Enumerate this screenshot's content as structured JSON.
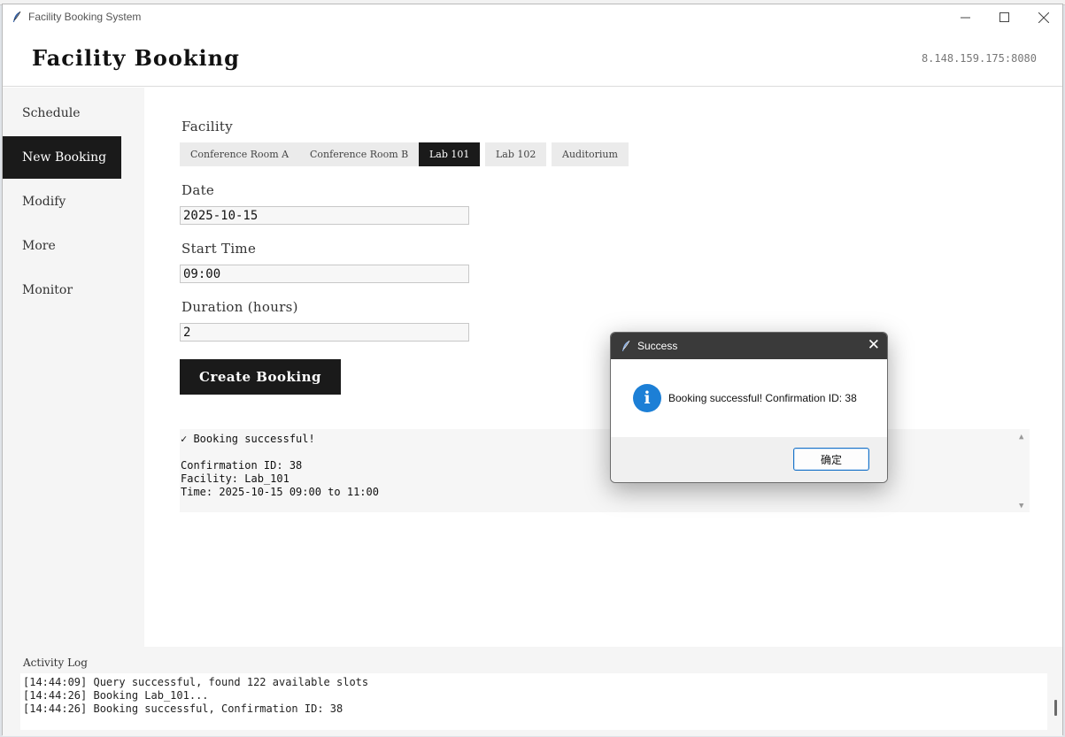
{
  "window": {
    "title": "Facility Booking System"
  },
  "header": {
    "title": "Facility Booking",
    "server": "8.148.159.175:8080"
  },
  "sidebar": {
    "items": [
      {
        "label": "Schedule",
        "active": false
      },
      {
        "label": "New Booking",
        "active": true
      },
      {
        "label": "Modify",
        "active": false
      },
      {
        "label": "More",
        "active": false
      },
      {
        "label": "Monitor",
        "active": false
      }
    ]
  },
  "form": {
    "facility_label": "Facility",
    "facilities": [
      {
        "label": "Conference Room A",
        "active": false
      },
      {
        "label": "Conference Room B",
        "active": false
      },
      {
        "label": "Lab 101",
        "active": true
      },
      {
        "label": "Lab 102",
        "active": false
      },
      {
        "label": "Auditorium",
        "active": false
      }
    ],
    "date_label": "Date",
    "date_value": "2025-10-15",
    "start_label": "Start Time",
    "start_value": "09:00",
    "duration_label": "Duration (hours)",
    "duration_value": "2",
    "create_button": "Create Booking"
  },
  "result": {
    "lines": [
      "✓ Booking successful!",
      "",
      "Confirmation ID: 38",
      "Facility: Lab_101",
      "Time: 2025-10-15 09:00 to 11:00"
    ]
  },
  "log": {
    "label": "Activity Log",
    "lines": [
      "[14:44:09] Query successful, found 122 available slots",
      "[14:44:26] Booking Lab_101...",
      "[14:44:26] Booking successful, Confirmation ID: 38"
    ]
  },
  "dialog": {
    "title": "Success",
    "icon": "info-icon",
    "info_glyph": "i",
    "message": "Booking successful! Confirmation ID: 38",
    "ok_label": "确定"
  },
  "colors": {
    "accent": "#1a1a1a",
    "info": "#1c7fd6"
  }
}
